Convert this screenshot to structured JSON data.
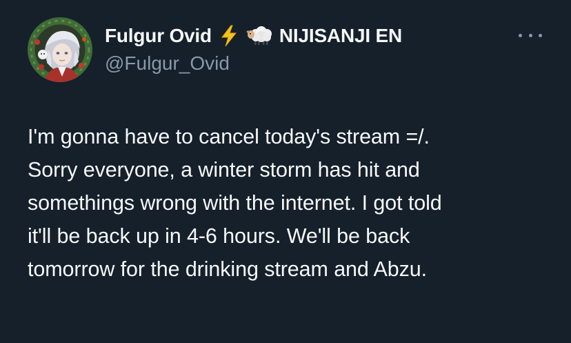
{
  "author": {
    "display_name": "Fulgur Ovid",
    "name_emojis": [
      "lightning-emoji",
      "sheep-emoji"
    ],
    "affiliation": "NIJISANJI EN",
    "handle": "@Fulgur_Ovid"
  },
  "tweet": {
    "lines": [
      "I'm gonna have to cancel today's stream =/.",
      "Sorry everyone, a winter storm has hit and",
      "somethings wrong with the internet. I got told",
      "it'll be back up in 4-6 hours. We'll be back",
      "tomorrow for the drinking stream and Abzu."
    ]
  },
  "colors": {
    "background": "#15202b",
    "text_primary": "#f7f9f9",
    "text_secondary": "#8b98a5",
    "lightning": "#f4c21f"
  },
  "icons": {
    "more": "more-options-icon"
  }
}
